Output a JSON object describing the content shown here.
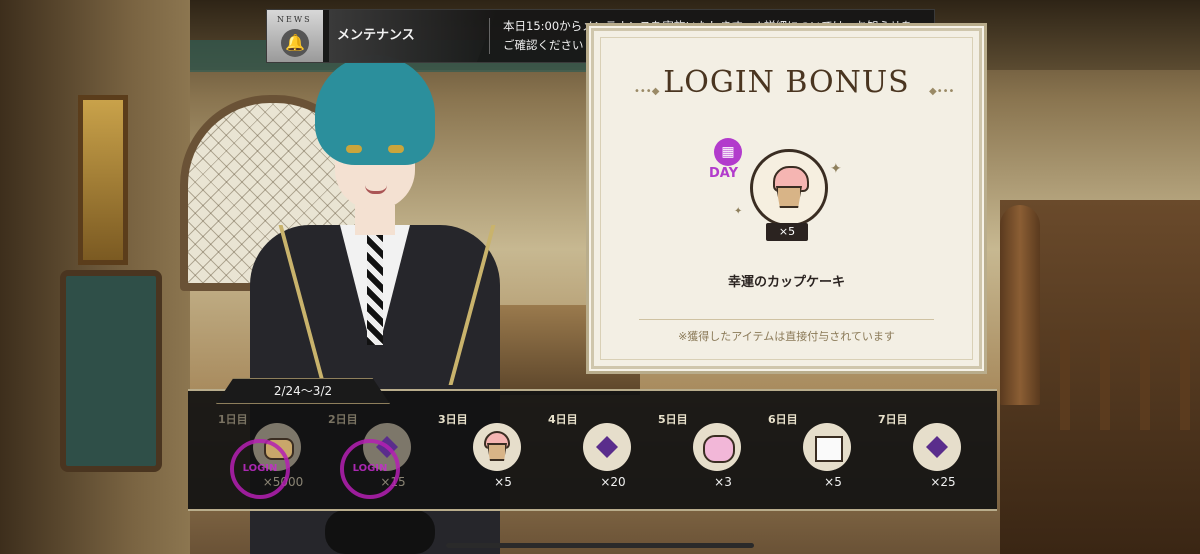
{
  "news": {
    "badge_label": "NEWS",
    "title": "メンテナンス",
    "body": "本日15:00からメンテナンスを実施いたします　※詳細については、お知らせをご確認ください"
  },
  "login_bonus": {
    "title": "LOGIN BONUS",
    "day_badge_label": "DAY",
    "prize_count": "×5",
    "prize_name": "幸運のカップケーキ",
    "note": "※獲得したアイテムは直接付与されています"
  },
  "calendar": {
    "date_range": "2/24〜3/2",
    "stamp_label": "LOGIN",
    "days": [
      {
        "label": "1日目",
        "count": "×5000",
        "item_icon": "bread-icon",
        "claimed": true
      },
      {
        "label": "2日目",
        "count": "×15",
        "item_icon": "gem-icon",
        "claimed": true
      },
      {
        "label": "3日目",
        "count": "×5",
        "item_icon": "cupcake-icon",
        "claimed": false
      },
      {
        "label": "4日目",
        "count": "×20",
        "item_icon": "gem-icon",
        "claimed": false
      },
      {
        "label": "5日目",
        "count": "×3",
        "item_icon": "candy-icon",
        "claimed": false
      },
      {
        "label": "6日目",
        "count": "×5",
        "item_icon": "sugar-cube-icon",
        "claimed": false
      },
      {
        "label": "7日目",
        "count": "×25",
        "item_icon": "gem-icon",
        "claimed": false
      }
    ]
  },
  "colors": {
    "accent_purple": "#b23bcc",
    "panel_bg": "#f3efe4",
    "bar_bg": "#121212"
  }
}
